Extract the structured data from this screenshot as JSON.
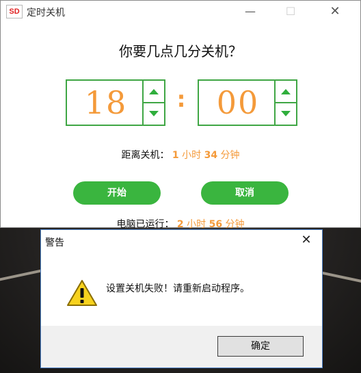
{
  "app": {
    "logo_text": "SD",
    "title": "定时关机",
    "question": "你要几点几分关机？",
    "hour": "18",
    "minute": "00",
    "colon": ":",
    "countdown": {
      "label": "距离关机：",
      "hours": "1",
      "hours_unit": "小时",
      "minutes": "34",
      "minutes_unit": "分钟"
    },
    "start_label": "开始",
    "cancel_label": "取消",
    "uptime": {
      "label": "电脑已运行：",
      "hours": "2",
      "hours_unit": "小时",
      "minutes": "56",
      "minutes_unit": "分钟"
    },
    "window_buttons": {
      "minimize": "—",
      "maximize": "☐",
      "close": "✕"
    }
  },
  "dialog": {
    "title": "警告",
    "close": "✕",
    "message": "设置关机失败！请重新启动程序。",
    "ok_label": "确定"
  },
  "colors": {
    "accent_green": "#3ab53f",
    "digit_orange": "#f49a3a"
  },
  "icons": [
    "app-logo-icon",
    "warning-icon",
    "close-icon",
    "spin-up-icon",
    "spin-down-icon"
  ]
}
